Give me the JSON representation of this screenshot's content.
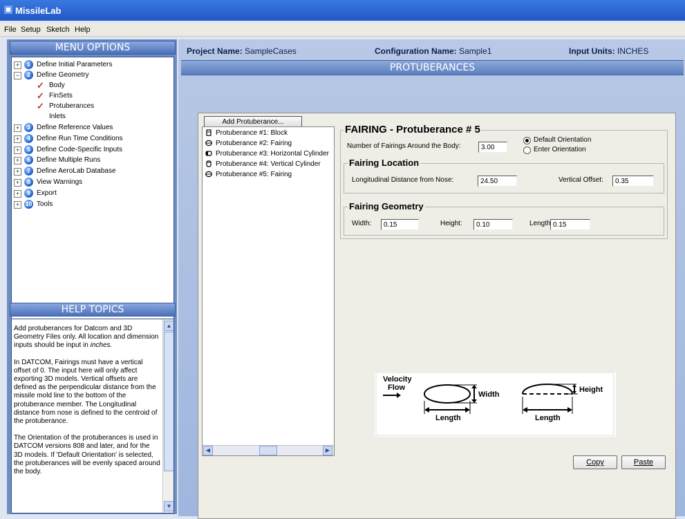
{
  "app": {
    "title": "MissileLab"
  },
  "menu": {
    "file": "File",
    "setup": "Setup",
    "sketch": "Sketch",
    "help": "Help"
  },
  "left": {
    "menu_header": "MENU OPTIONS",
    "help_header": "HELP TOPICS",
    "tree": [
      {
        "num": "1",
        "label": "Define Initial Parameters",
        "expander": "+"
      },
      {
        "num": "2",
        "label": "Define Geometry",
        "expander": "−"
      },
      {
        "num": "3",
        "label": "Define Reference Values",
        "expander": "+"
      },
      {
        "num": "4",
        "label": "Define Run Time Conditions",
        "expander": "+"
      },
      {
        "num": "5",
        "label": "Define Code-Specific Inputs",
        "expander": "+"
      },
      {
        "num": "6",
        "label": "Define Multiple Runs",
        "expander": "+"
      },
      {
        "num": "7",
        "label": "Define AeroLab Database",
        "expander": "+"
      },
      {
        "num": "8",
        "label": "View Warnings",
        "expander": "+"
      },
      {
        "num": "9",
        "label": "Export",
        "expander": "+"
      },
      {
        "num": "10",
        "label": "Tools",
        "expander": "+"
      }
    ],
    "geometry_children": [
      "Body",
      "FinSets",
      "Protuberances",
      "Inlets"
    ],
    "help_text": {
      "p1a": "Add protuberances for Datcom and 3D Geometry Files only.  All location and dimension inputs should be input in ",
      "p1b": "inches.",
      "p2": "In DATCOM, Fairings must have a vertical offset of 0.  The input here will only affect exporting 3D models.  Vertical offsets are defined as the perpendicular distance from the missile mold line to the bottom of the protuberance member.  The Longitudinal distance from nose is defined to the centroid of the protuberance.",
      "p3": "The Orientation of the protuberances is used in DATCOM versions 808 and later, and for the 3D models.  If 'Default Orientation' is selected, the protuberances will be evenly spaced around the body."
    }
  },
  "header": {
    "project_label": "Project Name:",
    "project_value": "SampleCases",
    "config_label": "Configuration Name:",
    "config_value": "Sample1",
    "units_label": "Input Units:",
    "units_value": "INCHES",
    "section_title": "PROTUBERANCES"
  },
  "protuberances": {
    "add_button": "Add Protuberance...",
    "items": [
      {
        "label": "Protuberance #1:  Block",
        "icon": "block-icon"
      },
      {
        "label": "Protuberance #2:  Fairing",
        "icon": "fairing-icon"
      },
      {
        "label": "Protuberance #3:  Horizontal Cylinder",
        "icon": "horizontal-cylinder-icon"
      },
      {
        "label": "Protuberance #4:  Vertical Cylinder",
        "icon": "vertical-cylinder-icon"
      },
      {
        "label": "Protuberance #5:  Fairing",
        "icon": "fairing-icon"
      }
    ]
  },
  "detail": {
    "title": "FAIRING - Protuberance # 5",
    "num_fairings_label": "Number of Fairings Around the Body:",
    "num_fairings_value": "3.00",
    "orientation_options": [
      "Default Orientation",
      "Enter Orientation"
    ],
    "orientation_selected": "Default Orientation",
    "location_title": "Fairing Location",
    "long_dist_label": "Longitudinal Distance from Nose:",
    "long_dist_value": "24.50",
    "vert_offset_label": "Vertical Offset:",
    "vert_offset_value": "0.35",
    "geometry_title": "Fairing Geometry",
    "width_label": "Width:",
    "width_value": "0.15",
    "height_label": "Height:",
    "height_value": "0.10",
    "length_label": "Length:",
    "length_value": "0.15"
  },
  "diagram": {
    "velocity": "Velocity",
    "flow": "Flow",
    "width": "Width",
    "height": "Height",
    "length1": "Length",
    "length2": "Length"
  },
  "buttons": {
    "copy": "Copy",
    "paste": "Paste"
  }
}
